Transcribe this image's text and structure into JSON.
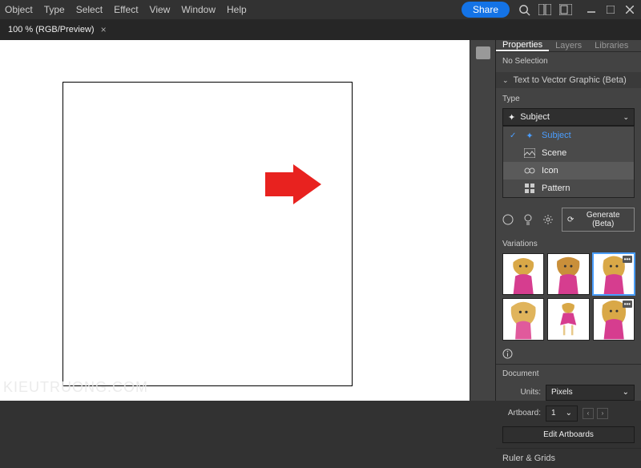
{
  "menu": {
    "items": [
      "Object",
      "Type",
      "Select",
      "Effect",
      "View",
      "Window",
      "Help"
    ],
    "share": "Share"
  },
  "docTab": {
    "label": "100 % (RGB/Preview)"
  },
  "panelTabs": {
    "properties": "Properties",
    "layers": "Layers",
    "libraries": "Libraries"
  },
  "noSelection": "No Selection",
  "t2v": {
    "title": "Text to Vector Graphic (Beta)",
    "typeLabel": "Type",
    "selected": "Subject",
    "options": [
      {
        "label": "Subject",
        "selected": true
      },
      {
        "label": "Scene"
      },
      {
        "label": "Icon",
        "hover": true
      },
      {
        "label": "Pattern"
      }
    ],
    "generate": "Generate (Beta)",
    "variations": "Variations"
  },
  "document": {
    "title": "Document",
    "unitsLabel": "Units:",
    "units": "Pixels",
    "artboardLabel": "Artboard:",
    "artboard": "1",
    "editArtboards": "Edit Artboards"
  },
  "ruler": {
    "title": "Ruler & Grids"
  },
  "watermark": "KIEUTRUONG.COM"
}
